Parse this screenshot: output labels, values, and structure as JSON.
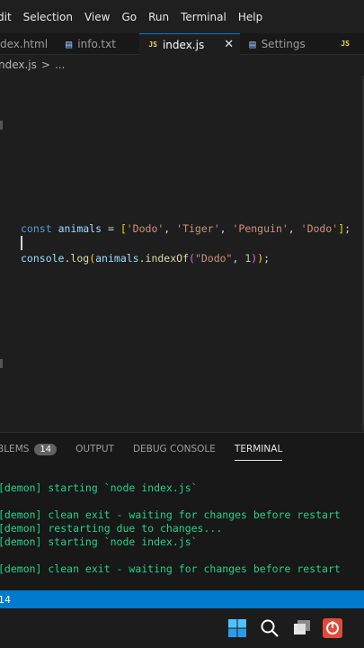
{
  "menubar": {
    "items": [
      "dit",
      "Selection",
      "View",
      "Go",
      "Run",
      "Terminal",
      "Help"
    ]
  },
  "tabs": [
    {
      "label": "dex.html",
      "icon": "html-icon",
      "active": false
    },
    {
      "label": "info.txt",
      "icon": "text-file-icon",
      "active": false
    },
    {
      "label": "index.js",
      "icon": "js-icon",
      "active": true,
      "icon_text": "JS"
    },
    {
      "label": "Settings",
      "icon": "settings-icon",
      "active": false
    },
    {
      "label": "",
      "icon": "js-icon",
      "active": false,
      "icon_text": "JS"
    }
  ],
  "breadcrumb": {
    "file": "ndex.js",
    "separator": ">",
    "rest": "..."
  },
  "editor": {
    "line1": {
      "kw": "const",
      "name": "animals",
      "eq": " = ",
      "open": "[",
      "s1": "'Dodo'",
      "s2": "'Tiger'",
      "s3": "'Penguin'",
      "s4": "'Dodo'",
      "sep": ", ",
      "close": "]",
      "end": ";"
    },
    "line3": {
      "obj": "console",
      "dot": ".",
      "method": "log",
      "open1": "(",
      "arg": "animals",
      "method2": "indexOf",
      "open2": "(",
      "s": "\"Dodo\"",
      "sep": ", ",
      "num": "1",
      "close2": ")",
      "close1": ")",
      "end": ";"
    }
  },
  "panel": {
    "tabs": [
      "BLEMS",
      "OUTPUT",
      "DEBUG CONSOLE",
      "TERMINAL"
    ],
    "problems_count": "14",
    "active_tab": "TERMINAL",
    "lines": [
      "[demon] starting `node index.js`",
      "[demon] clean exit - waiting for changes before restart",
      "[demon] restarting due to changes...",
      "[demon] starting `node index.js`",
      "[demon] clean exit - waiting for changes before restart"
    ]
  },
  "statusbar": {
    "text": "14"
  },
  "colors": {
    "accent": "#007acc",
    "terminal_text": "#23d18b",
    "editor_bg": "#1e1e1e"
  }
}
